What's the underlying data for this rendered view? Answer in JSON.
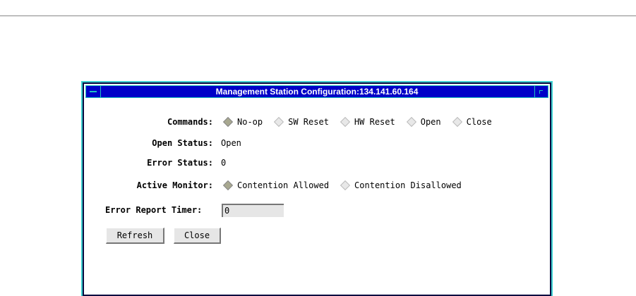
{
  "window": {
    "title": "Management Station Configuration:134.141.60.164"
  },
  "commands": {
    "label": "Commands:",
    "options": [
      "No-op",
      "SW Reset",
      "HW Reset",
      "Open",
      "Close"
    ],
    "selected": 0
  },
  "open_status": {
    "label": "Open Status:",
    "value": "Open"
  },
  "error_status": {
    "label": "Error Status:",
    "value": "0"
  },
  "active_monitor": {
    "label": "Active Monitor:",
    "options": [
      "Contention Allowed",
      "Contention Disallowed"
    ],
    "selected": 0
  },
  "error_report_timer": {
    "label": "Error Report Timer:",
    "value": "0"
  },
  "buttons": {
    "refresh": "Refresh",
    "close": "Close"
  }
}
